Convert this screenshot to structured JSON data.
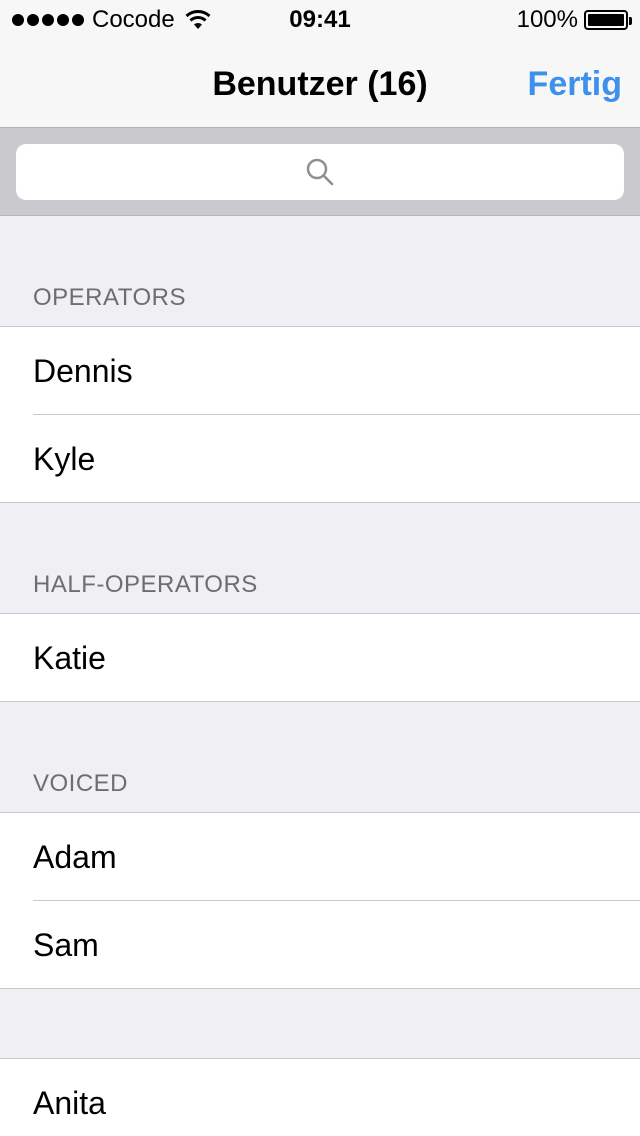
{
  "status_bar": {
    "carrier": "Cocode",
    "time": "09:41",
    "battery_percent": "100%"
  },
  "nav": {
    "title": "Benutzer (16)",
    "done_label": "Fertig"
  },
  "search": {
    "placeholder": ""
  },
  "sections": [
    {
      "header": "OPERATORS",
      "users": [
        "Dennis",
        "Kyle"
      ]
    },
    {
      "header": "HALF-OPERATORS",
      "users": [
        "Katie"
      ]
    },
    {
      "header": "VOICED",
      "users": [
        "Adam",
        "Sam"
      ]
    },
    {
      "header": "",
      "users": [
        "Anita"
      ]
    }
  ],
  "colors": {
    "accent": "#3d91ea",
    "background": "#efeff4",
    "section_header_text": "#6d6d72",
    "separator": "#c8c7cc"
  },
  "icons": {
    "search": "search-icon",
    "wifi": "wifi-icon",
    "battery": "battery-icon",
    "signal": "signal-icon"
  }
}
